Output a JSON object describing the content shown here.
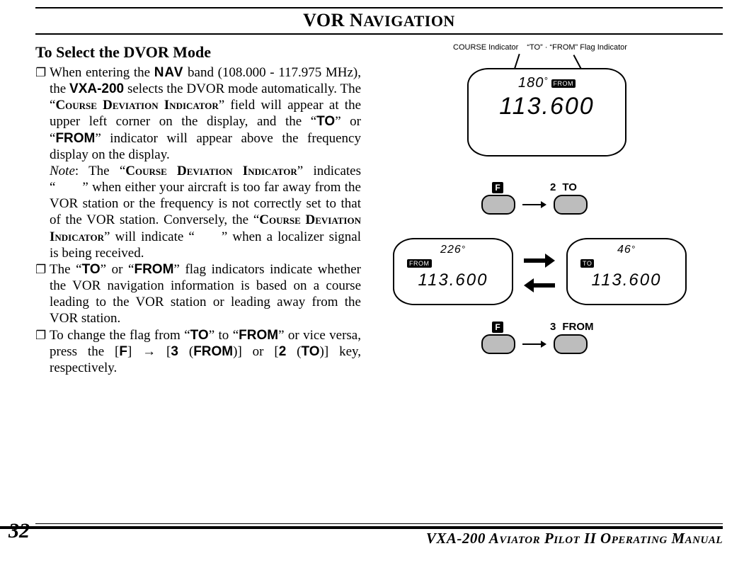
{
  "header": {
    "title_main": "VOR N",
    "title_sc": "AVIGATION"
  },
  "heading": "To Select the DVOR Mode",
  "bullets": {
    "b1_a": "When entering the ",
    "b1_nav": "NAV",
    "b1_b": " band (108.000 - 117.975 MHz), the ",
    "b1_model": "VXA-200",
    "b1_c": " selects the DVOR mode automatically. The “",
    "b1_cdi1": "Course Deviation Indicator",
    "b1_d": "” field will appear at the upper left corner on the display, and the “",
    "b1_to": "TO",
    "b1_e": "” or “",
    "b1_from": "FROM",
    "b1_f": "” indicator will appear above the frequency display on the display.",
    "note_label": "Note",
    "note_a": ": The “",
    "note_cdi": "Course Deviation Indicator",
    "note_b": "” indicates “  ” when either your aircraft is too far away from the VOR station or the frequency is not correctly set to that of the VOR station. Conversely, the “",
    "note_cdi2": "Course Deviation Indicator",
    "note_c": "” will indicate “  ” when a localizer signal is being received.",
    "b2_a": "The “",
    "b2_to": "TO",
    "b2_b": "” or “",
    "b2_from": "FROM",
    "b2_c": "” flag indicators indicate whether the VOR navigation information is based on a course leading to the VOR station or leading away from the VOR station.",
    "b3_a": "To change the flag from “",
    "b3_to": "TO",
    "b3_b": "” to “",
    "b3_from": "FROM",
    "b3_c": "” or vice versa, press the [",
    "b3_F": "F",
    "b3_d": "] → [",
    "b3_3": "3",
    "b3_e": " (",
    "b3_from2": "FROM",
    "b3_f": ")] or [",
    "b3_2": "2",
    "b3_g": " (",
    "b3_to2": "TO",
    "b3_h": ")] key, respectively."
  },
  "figures": {
    "callout1": "COURSE Indicator",
    "callout2": "“TO” · “FROM” Flag Indicator",
    "lcd_top_deg": "180",
    "lcd_top_tag": "FROM",
    "lcd_top_freq": "113.600",
    "key_row1_f": "F",
    "key_row1_num": "2",
    "key_row1_lbl": "TO",
    "lcd_left_deg": "226",
    "lcd_left_tag": "FROM",
    "lcd_left_freq": "113.600",
    "lcd_right_deg": "46",
    "lcd_right_tag": "TO",
    "lcd_right_freq": "113.600",
    "key_row2_f": "F",
    "key_row2_num": "3",
    "key_row2_lbl": "FROM"
  },
  "footer": {
    "page": "32",
    "title": "VXA-200 Aviator Pilot II Operating Manual"
  }
}
